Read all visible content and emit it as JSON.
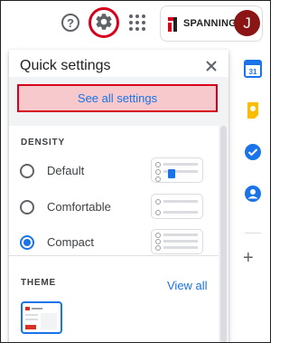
{
  "topbar": {
    "help_icon": "help-icon",
    "settings_icon": "gear-icon",
    "apps_icon": "apps-grid-icon",
    "brand_name": "SPANNING",
    "avatar_letter": "J",
    "highlight_color": "#d6001c",
    "avatar_color": "#8b1414"
  },
  "quick_settings": {
    "title": "Quick settings",
    "see_all_label": "See all settings",
    "density": {
      "heading": "DENSITY",
      "options": [
        {
          "label": "Default",
          "selected": false
        },
        {
          "label": "Comfortable",
          "selected": false
        },
        {
          "label": "Compact",
          "selected": true
        }
      ]
    },
    "theme": {
      "heading": "THEME",
      "view_all_label": "View all"
    }
  },
  "side_rail": {
    "items": [
      "calendar-icon",
      "keep-icon",
      "tasks-icon",
      "contacts-icon",
      "add-icon"
    ],
    "calendar_day": "31",
    "add_label": "+"
  },
  "colors": {
    "accent": "#1a73e8",
    "see_all_background": "#f8c9cc"
  }
}
